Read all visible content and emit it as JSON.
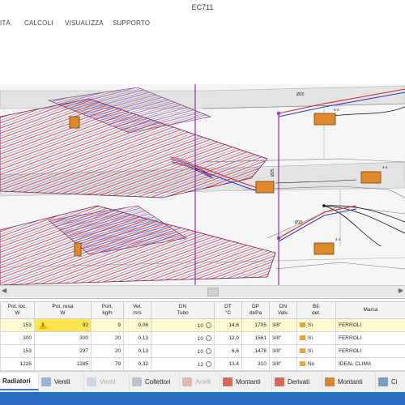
{
  "window": {
    "title": "EC711"
  },
  "menu": [
    "ITÀ",
    "CALCOLI",
    "VISUALIZZA",
    "SUPPORTO"
  ],
  "drawing": {
    "labels": [
      "Ø20",
      "Ø25",
      "Ø15",
      "4-3",
      "4-4",
      "4-3"
    ]
  },
  "table": {
    "headers": [
      "Pot. loc.\nW",
      "Pot. resa\nW",
      "Port.\nkg/h",
      "Vel.\nm/s",
      "DN\nTubo",
      "DT\n°C",
      "DP\ndePa",
      "DN\nValv.",
      "Bil.\ndet.",
      "Marca"
    ],
    "rows": [
      {
        "pot_loc": "153",
        "pot_resa": "92",
        "port": "9",
        "vel": "0,06",
        "dn_tubo": "10",
        "dt": "14,6",
        "dp": "1705",
        "dn_valv": "3/8\"",
        "bil": "Sì",
        "marca": "FERROLI",
        "warn": true
      },
      {
        "pot_loc": "300",
        "pot_resa": "300",
        "port": "20",
        "vel": "0,13",
        "dn_tubo": "10",
        "dt": "12,9",
        "dp": "1561",
        "dn_valv": "3/8\"",
        "bil": "Sì",
        "marca": "FERROLI",
        "warn": false
      },
      {
        "pot_loc": "153",
        "pot_resa": "297",
        "port": "20",
        "vel": "0,13",
        "dn_tubo": "10",
        "dt": "6,6",
        "dp": "1478",
        "dn_valv": "3/8\"",
        "bil": "Sì",
        "marca": "FERROLI",
        "warn": false
      },
      {
        "pot_loc": "1225",
        "pot_resa": "1285",
        "port": "79",
        "vel": "0,32",
        "dn_tubo": "12",
        "dt": "13,4",
        "dp": "310",
        "dn_valv": "3/8\"",
        "bil": "No",
        "marca": "IDEAL CLIMA",
        "warn": false
      }
    ]
  },
  "tabs": [
    {
      "label": "Radiatori",
      "active": true,
      "disabled": false,
      "icon": "radiator-icon",
      "color": "#c9d7ea"
    },
    {
      "label": "Ventil",
      "active": false,
      "disabled": false,
      "icon": "fan-icon",
      "color": "#9bb3d4"
    },
    {
      "label": "Ventil",
      "active": false,
      "disabled": true,
      "icon": "fan-icon",
      "color": "#cfd8e4"
    },
    {
      "label": "Collettori",
      "active": false,
      "disabled": false,
      "icon": "manifold-icon",
      "color": "#b9c2cc"
    },
    {
      "label": "Anelli",
      "active": false,
      "disabled": true,
      "icon": "ring-icon",
      "color": "#e0b8b0"
    },
    {
      "label": "Montanti",
      "active": false,
      "disabled": false,
      "icon": "riser-icon",
      "color": "#d46b5a"
    },
    {
      "label": "Derivati",
      "active": false,
      "disabled": false,
      "icon": "branch-icon",
      "color": "#d46b5a"
    },
    {
      "label": "Montanti",
      "active": false,
      "disabled": false,
      "icon": "riser-icon",
      "color": "#d9823a"
    },
    {
      "label": "Ci",
      "active": false,
      "disabled": false,
      "icon": "circuit-icon",
      "color": "#7a9cc8"
    }
  ],
  "colors": {
    "accent": "#2b6cc4",
    "highlight": "#ffe44d",
    "pipe_red": "#d9261c",
    "pipe_blue": "#2a3bd6",
    "riser": "#9a2fb0"
  }
}
